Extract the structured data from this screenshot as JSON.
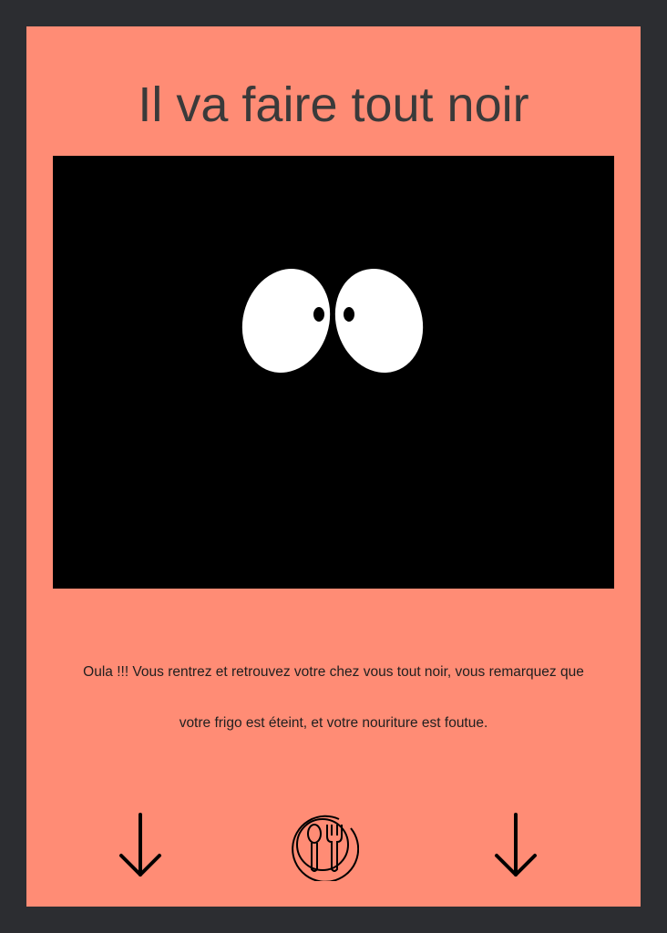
{
  "page": {
    "title": "Il va faire tout noir",
    "story_line_1": "Oula !!! Vous rentrez et retrouvez votre chez vous tout noir, vous remarquez que",
    "story_line_2": "votre frigo est éteint, et votre nouriture est foutue."
  },
  "icons": {
    "scene": "eyes-in-dark-illustration",
    "left": "arrow-down-icon",
    "center": "plate-spoon-fork-icon",
    "right": "arrow-down-icon"
  },
  "colors": {
    "background": "#2c2d31",
    "card": "#ff8c75",
    "scene": "#000000",
    "title": "#3a3a3a",
    "text": "#1f1f1f"
  }
}
